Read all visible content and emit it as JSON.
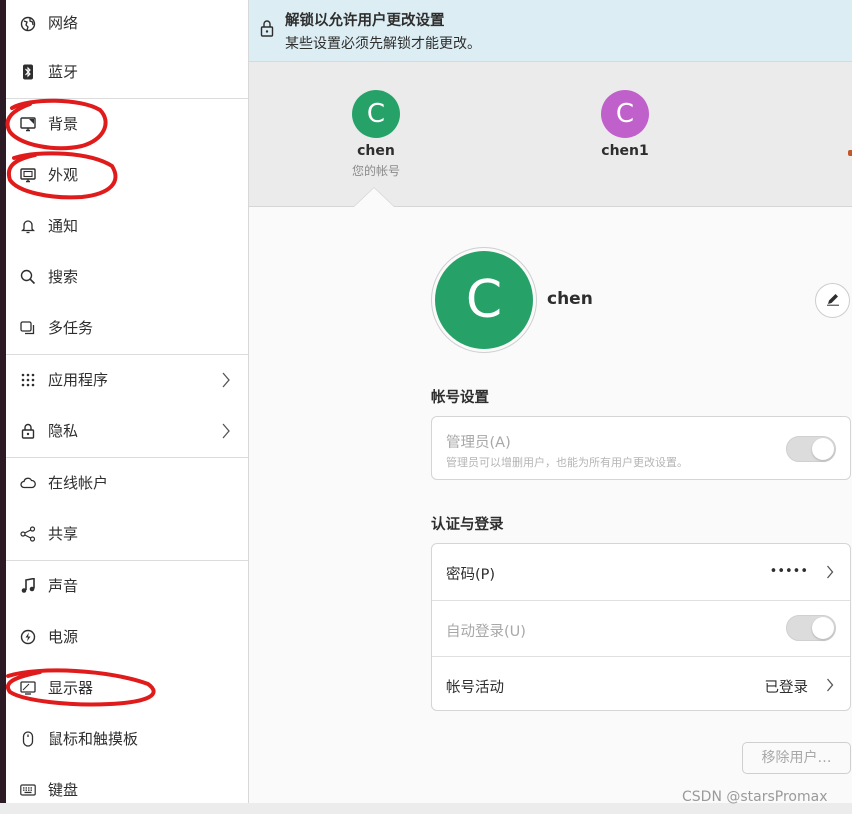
{
  "sidebar": {
    "items": [
      {
        "label": "网络",
        "icon": "globe-icon"
      },
      {
        "label": "蓝牙",
        "icon": "bluetooth-icon"
      },
      {
        "label": "背景",
        "icon": "monitor-icon"
      },
      {
        "label": "外观",
        "icon": "appearance-icon"
      },
      {
        "label": "通知",
        "icon": "bell-icon"
      },
      {
        "label": "搜索",
        "icon": "search-icon"
      },
      {
        "label": "多任务",
        "icon": "multitask-icon"
      },
      {
        "label": "应用程序",
        "icon": "apps-grid-icon"
      },
      {
        "label": "隐私",
        "icon": "lock-icon"
      },
      {
        "label": "在线帐户",
        "icon": "cloud-icon"
      },
      {
        "label": "共享",
        "icon": "share-icon"
      },
      {
        "label": "声音",
        "icon": "music-note-icon"
      },
      {
        "label": "电源",
        "icon": "power-icon"
      },
      {
        "label": "显示器",
        "icon": "display-icon"
      },
      {
        "label": "鼠标和触摸板",
        "icon": "mouse-icon"
      },
      {
        "label": "键盘",
        "icon": "keyboard-icon"
      }
    ]
  },
  "unlock_bar": {
    "title": "解锁以允许用户更改设置",
    "subtitle": "某些设置必须先解锁才能更改。"
  },
  "users": [
    {
      "initial": "C",
      "name": "chen",
      "subtitle": "您的帐号",
      "color": "#26a269"
    },
    {
      "initial": "C",
      "name": "chen1",
      "subtitle": "",
      "color": "#c061cb"
    }
  ],
  "current_user": {
    "initial": "C",
    "name": "chen",
    "color": "#26a269"
  },
  "account_settings": {
    "title": "帐号设置",
    "admin_label": "管理员(A)",
    "admin_desc": "管理员可以增删用户，也能为所有用户更改设置。"
  },
  "auth": {
    "title": "认证与登录",
    "password_label": "密码(P)",
    "password_value": "•••••",
    "autologin_label": "自动登录(U)",
    "activity_label": "帐号活动",
    "activity_value": "已登录"
  },
  "remove_user_label": "移除用户…",
  "watermark": "CSDN @starsPromax",
  "colors": {
    "accent_green": "#26a269",
    "accent_purple": "#c061cb",
    "annotation_red": "#e01b1b",
    "info_bar": "#dcedf3"
  }
}
